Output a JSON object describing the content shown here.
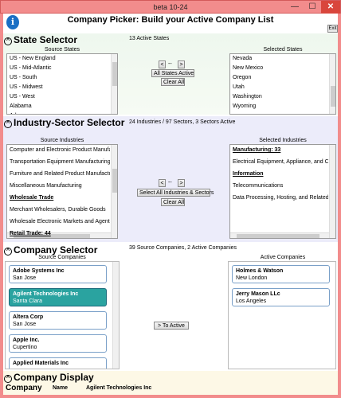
{
  "window": {
    "title": "beta 10-24",
    "minimize": "—",
    "maximize": "☐",
    "close": "✕"
  },
  "header": {
    "info_icon": "i",
    "title": "Company Picker: Build your Active Company List",
    "exit_label": "Exit"
  },
  "states": {
    "heading": "State Selector",
    "status": "13 Active States",
    "source_label": "Source States",
    "selected_label": "Selected States",
    "source_items": [
      "US - New England",
      "US - Mid-Atlantic",
      "US - South",
      "US - Midwest",
      "US - West",
      "Alabama",
      "Arkansas"
    ],
    "selected_items": [
      "Nevada",
      "New Mexico",
      "Oregon",
      "Utah",
      "Washington",
      "Wyoming"
    ],
    "btn_left": "<",
    "btn_right": ">",
    "btn_sep": "--",
    "btn_all": "All States Active",
    "btn_clear": "Clear All"
  },
  "industries": {
    "heading": "Industry-Sector Selector",
    "status": "24 Industries / 97 Sectors, 3 Sectors Active",
    "source_label": "Source Industries",
    "selected_label": "Selected Industries",
    "source_items": [
      {
        "text": "Computer and Electronic Product Manufacturing",
        "header": false
      },
      {
        "text": "Transportation Equipment Manufacturing",
        "header": false
      },
      {
        "text": "Furniture and Related Product Manufacturing",
        "header": false
      },
      {
        "text": "Miscellaneous Manufacturing",
        "header": false
      },
      {
        "text": "Wholesale Trade",
        "header": true
      },
      {
        "text": "Merchant Wholesalers, Durable Goods",
        "header": false
      },
      {
        "text": "Wholesale Electronic Markets and Agents",
        "header": false
      },
      {
        "text": "Retail Trade: 44",
        "header": true
      }
    ],
    "selected_items": [
      {
        "text": "Manufacturing: 33",
        "header": true
      },
      {
        "text": "Electrical Equipment, Appliance, and Component",
        "header": false
      },
      {
        "text": "Information",
        "header": true
      },
      {
        "text": "Telecommunications",
        "header": false
      },
      {
        "text": "Data Processing, Hosting, and Related Services",
        "header": false
      }
    ],
    "btn_left": "<",
    "btn_right": ">",
    "btn_sep": "--",
    "btn_all": "Select All Industries & Sectors",
    "btn_clear": "Clear All"
  },
  "companies": {
    "heading": "Company Selector",
    "status": "39 Source Companies, 2 Active Companies",
    "source_label": "Source Companies",
    "active_label": "Active Companies",
    "to_active": "> To Active",
    "source": [
      {
        "name": "Adobe Systems Inc",
        "city": "San Jose",
        "selected": false
      },
      {
        "name": "Agilent Technologies Inc",
        "city": "Santa Clara",
        "selected": true
      },
      {
        "name": "Altera Corp",
        "city": "San Jose",
        "selected": false
      },
      {
        "name": "Apple Inc.",
        "city": "Cupertino",
        "selected": false
      },
      {
        "name": "Applied Materials Inc",
        "city": "",
        "selected": false
      }
    ],
    "active": [
      {
        "name": "Holmes & Watson",
        "city": "New London"
      },
      {
        "name": "Jerry Mason LLc",
        "city": "Los Angeles"
      }
    ]
  },
  "display": {
    "heading": "Company Display",
    "sub_label": "Company",
    "name_label": "Name",
    "name_value": "Agilent Technologies Inc"
  },
  "colors": {
    "title_bar": "#f28c8c",
    "selected_card": "#2aa3a0",
    "states_bg": "#eef7ee",
    "industry_bg": "#ececfa",
    "display_bg": "#fdf8e6"
  }
}
